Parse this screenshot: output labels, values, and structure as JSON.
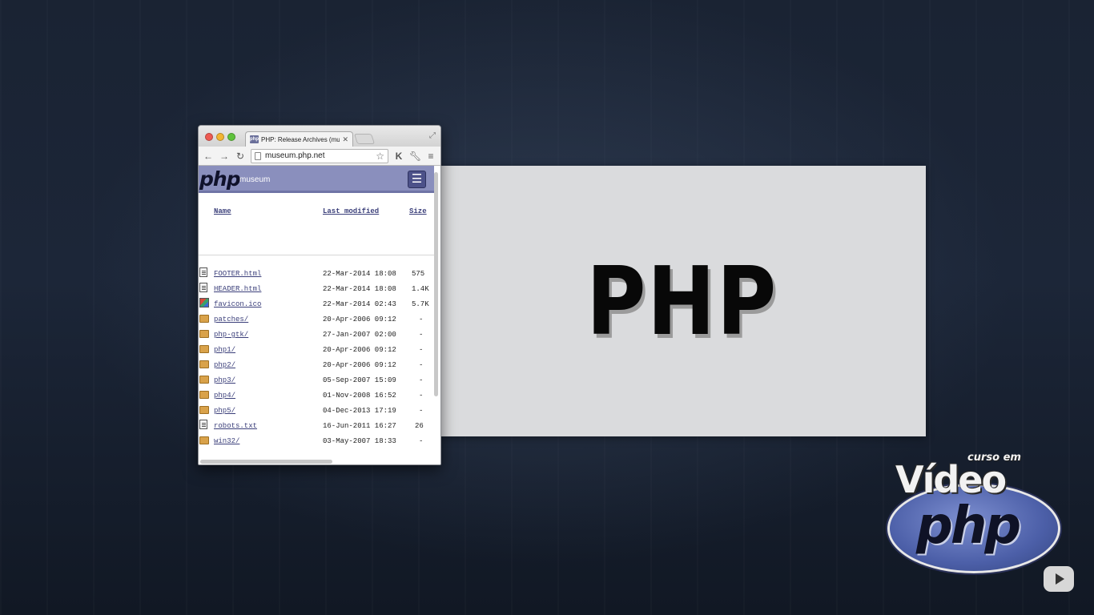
{
  "browser": {
    "tab_title": "PHP: Release Archives (mu",
    "tab_favicon": "php",
    "url": "museum.php.net"
  },
  "site": {
    "logo": "php",
    "logo_sub": "museum",
    "menu_icon": "hamburger-icon"
  },
  "listing": {
    "headers": {
      "name": "Name",
      "modified": "Last modified",
      "size": "Size"
    },
    "rows": [
      {
        "name": "FOOTER.html",
        "modified": "22-Mar-2014 18:08",
        "size": "575",
        "icon": "file"
      },
      {
        "name": "HEADER.html",
        "modified": "22-Mar-2014 18:08",
        "size": "1.4K",
        "icon": "file"
      },
      {
        "name": "favicon.ico",
        "modified": "22-Mar-2014 02:43",
        "size": "5.7K",
        "icon": "image"
      },
      {
        "name": "patches/",
        "modified": "20-Apr-2006 09:12",
        "size": "-",
        "icon": "folder"
      },
      {
        "name": "php-gtk/",
        "modified": "27-Jan-2007 02:00",
        "size": "-",
        "icon": "folder"
      },
      {
        "name": "php1/",
        "modified": "20-Apr-2006 09:12",
        "size": "-",
        "icon": "folder"
      },
      {
        "name": "php2/",
        "modified": "20-Apr-2006 09:12",
        "size": "-",
        "icon": "folder"
      },
      {
        "name": "php3/",
        "modified": "05-Sep-2007 15:09",
        "size": "-",
        "icon": "folder"
      },
      {
        "name": "php4/",
        "modified": "01-Nov-2008 16:52",
        "size": "-",
        "icon": "folder"
      },
      {
        "name": "php5/",
        "modified": "04-Dec-2013 17:19",
        "size": "-",
        "icon": "folder"
      },
      {
        "name": "robots.txt",
        "modified": "16-Jun-2011 16:27",
        "size": "26",
        "icon": "file"
      },
      {
        "name": "win32/",
        "modified": "03-May-2007 18:33",
        "size": "-",
        "icon": "folder"
      }
    ]
  },
  "slide": {
    "text": "PHP"
  },
  "channel": {
    "curso": "curso em",
    "video": "Vídeo",
    "php": "php",
    "watermark_icon": "youtube-play-icon"
  }
}
